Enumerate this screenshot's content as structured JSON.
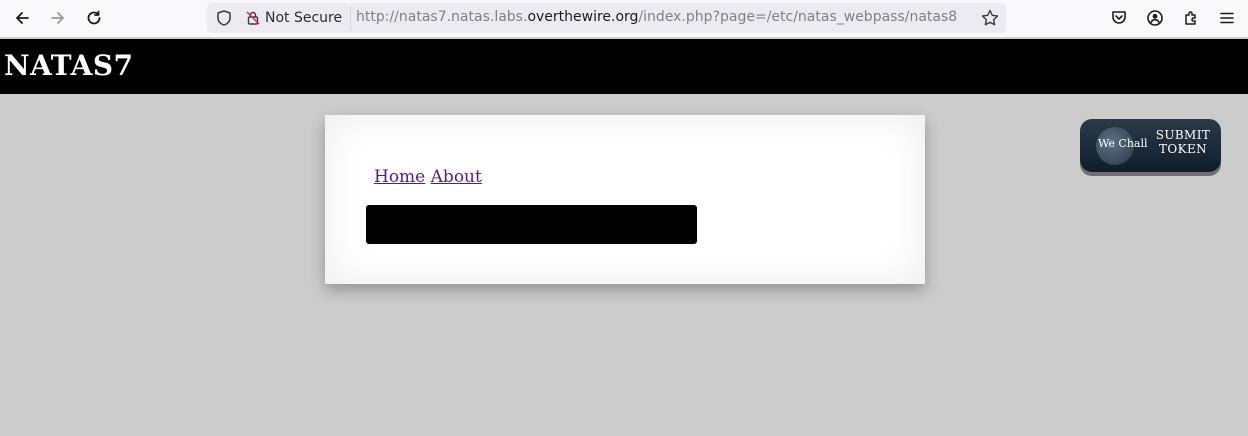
{
  "browser": {
    "back_icon": "arrow-left-icon",
    "forward_icon": "arrow-right-icon",
    "reload_icon": "reload-icon",
    "security_label": "Not Secure",
    "url_prefix": "http://natas7.natas.labs.",
    "url_domain": "overthewire.org",
    "url_path": "/index.php?page=/etc/natas_webpass/natas8"
  },
  "header": {
    "title": "NATAS7"
  },
  "nav": {
    "home": "Home",
    "about": "About"
  },
  "wechall": {
    "logo_text": "We Chall",
    "line1": "SUBMIT",
    "line2": "TOKEN"
  }
}
